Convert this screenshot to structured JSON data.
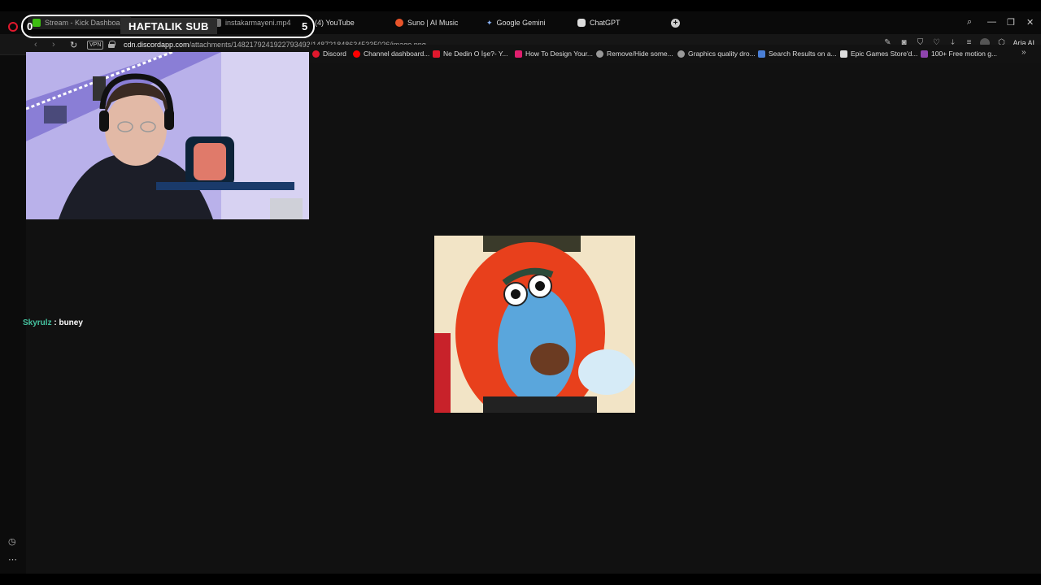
{
  "tabs": [
    {
      "label": "Stream - Kick Dashboard",
      "icon": "kick-icon",
      "color": "#53fc18"
    },
    {
      "label": "instakarmayeni.mp4",
      "icon": "file-icon",
      "color": "#999999"
    },
    {
      "label": "(4) YouTube",
      "icon": "youtube-icon",
      "color": "#ff0000"
    },
    {
      "label": "Suno | AI Music",
      "icon": "suno-icon",
      "color": "#e8542a"
    },
    {
      "label": "Google Gemini",
      "icon": "gemini-icon",
      "color": "#8ab4f8"
    },
    {
      "label": "ChatGPT",
      "icon": "chatgpt-icon",
      "color": "#dddddd"
    }
  ],
  "address": {
    "host": "cdn.discordapp.com",
    "path": "/attachments/1482179241922793493/1487218486345335026/image.png",
    "vpn_label": "VPN"
  },
  "toolbar": {
    "ai_label": "Aria AI"
  },
  "bookmarks": [
    {
      "label": "Discord",
      "color": "#e0182d"
    },
    {
      "label": "Channel dashboard...",
      "color": "#ff0000"
    },
    {
      "label": "Ne Dedin O İşe?- Y...",
      "color": "#e0182d"
    },
    {
      "label": "How To Design Your...",
      "color": "#e01f6e"
    },
    {
      "label": "Remove/Hide some...",
      "color": "#999999"
    },
    {
      "label": "Graphics quality dro...",
      "color": "#999999"
    },
    {
      "label": "Search Results on a...",
      "color": "#4a7fd6"
    },
    {
      "label": "Epic Games Store'd...",
      "color": "#dddddd"
    },
    {
      "label": "100+ Free motion g...",
      "color": "#8e44ad"
    }
  ],
  "overlay": {
    "sub_start": "0",
    "sub_title": "HAFTALIK SUB",
    "sub_goal": "5"
  },
  "chat": {
    "username": "Skyrulz",
    "separator": " : ",
    "message": "buney",
    "username_color": "#46c3a0"
  },
  "image": {
    "description_alt": "image.png"
  }
}
